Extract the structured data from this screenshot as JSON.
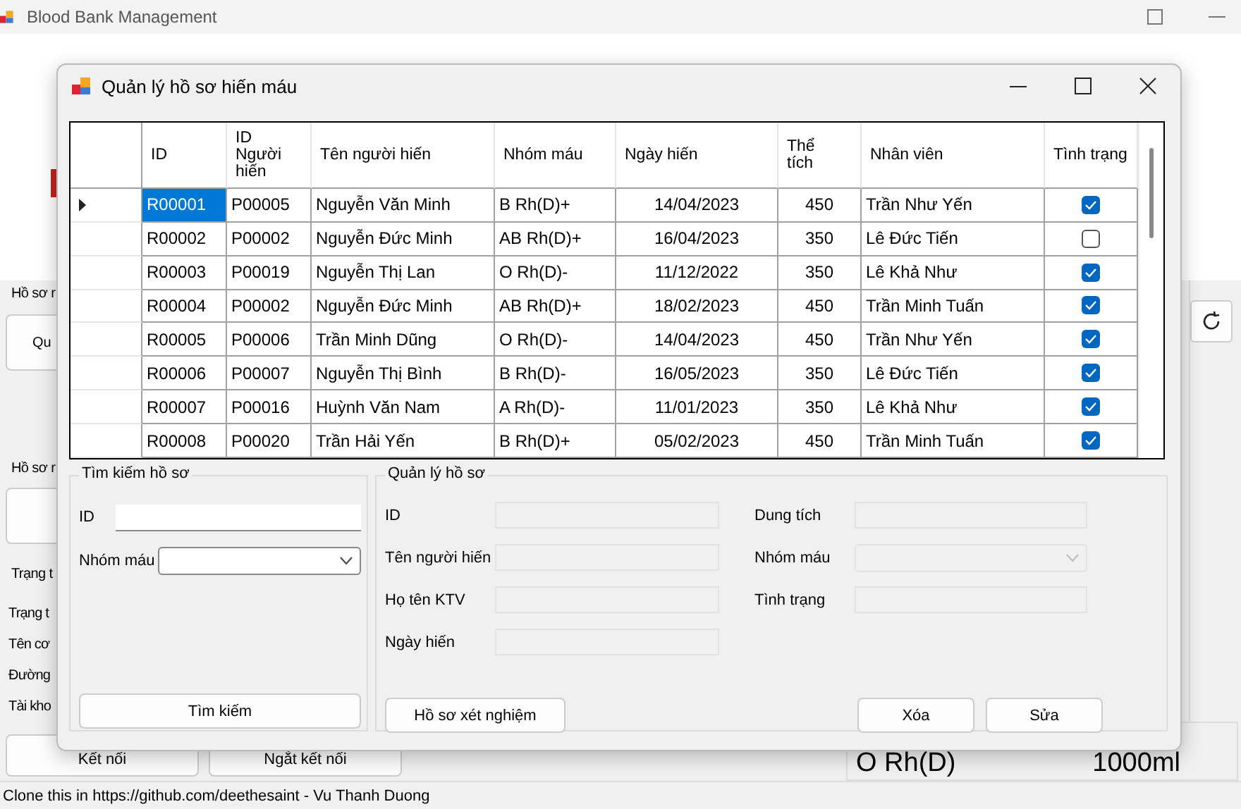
{
  "main_window": {
    "title": "Blood Bank Management"
  },
  "background": {
    "groups": [
      {
        "label": "Hồ sơ r",
        "button": "Qu"
      },
      {
        "label": "Hồ sơ r"
      }
    ],
    "status_group": {
      "label": "Trạng t",
      "lines": [
        "Trạng t",
        "Tên cơ",
        "Đường",
        "Tài kho"
      ]
    },
    "buttons": [
      "Kết nối",
      "Ngắt kết nối"
    ],
    "summary": [
      "O Rh(D)",
      "1000ml"
    ]
  },
  "status_bar": "Clone this in https://github.com/deethesaint - Vu Thanh Duong",
  "dialog": {
    "title": "Quản lý hồ sơ hiến máu",
    "table": {
      "columns": [
        "ID",
        "ID\nNgười\nhiến",
        "Tên người hiến",
        "Nhóm máu",
        "Ngày hiến",
        "Thể\ntích",
        "Nhân viên",
        "Tình trạng"
      ],
      "rows": [
        {
          "id": "R00001",
          "donor_id": "P00005",
          "name": "Nguyễn Văn Minh",
          "blood": "B Rh(D)+",
          "date": "14/04/2023",
          "volume": "450",
          "staff": "Trần Như Yến",
          "checked": true,
          "selected": true
        },
        {
          "id": "R00002",
          "donor_id": "P00002",
          "name": "Nguyễn Đức Minh",
          "blood": "AB Rh(D)+",
          "date": "16/04/2023",
          "volume": "350",
          "staff": "Lê Đức Tiến",
          "checked": false,
          "selected": false
        },
        {
          "id": "R00003",
          "donor_id": "P00019",
          "name": "Nguyễn Thị Lan",
          "blood": "O Rh(D)-",
          "date": "11/12/2022",
          "volume": "350",
          "staff": "Lê Khả Như",
          "checked": true,
          "selected": false
        },
        {
          "id": "R00004",
          "donor_id": "P00002",
          "name": "Nguyễn Đức Minh",
          "blood": "AB Rh(D)+",
          "date": "18/02/2023",
          "volume": "450",
          "staff": "Trần Minh Tuấn",
          "checked": true,
          "selected": false
        },
        {
          "id": "R00005",
          "donor_id": "P00006",
          "name": "Trần Minh Dũng",
          "blood": "O Rh(D)-",
          "date": "14/04/2023",
          "volume": "450",
          "staff": "Trần Như Yến",
          "checked": true,
          "selected": false
        },
        {
          "id": "R00006",
          "donor_id": "P00007",
          "name": "Nguyễn Thị Bình",
          "blood": "B Rh(D)-",
          "date": "16/05/2023",
          "volume": "350",
          "staff": "Lê Đức Tiến",
          "checked": true,
          "selected": false
        },
        {
          "id": "R00007",
          "donor_id": "P00016",
          "name": "Huỳnh Văn Nam",
          "blood": "A Rh(D)-",
          "date": "11/01/2023",
          "volume": "350",
          "staff": "Lê Khả Như",
          "checked": true,
          "selected": false
        },
        {
          "id": "R00008",
          "donor_id": "P00020",
          "name": "Trần Hải Yến",
          "blood": "B Rh(D)+",
          "date": "05/02/2023",
          "volume": "450",
          "staff": "Trần Minh Tuấn",
          "checked": true,
          "selected": false
        }
      ]
    },
    "search": {
      "title": "Tìm kiếm hồ sơ",
      "fields": [
        {
          "label": "ID",
          "kind": "text"
        },
        {
          "label": "Nhóm máu",
          "kind": "combo"
        }
      ],
      "button": "Tìm kiếm"
    },
    "manage": {
      "title": "Quản lý hồ sơ",
      "left_fields": [
        {
          "label": "ID",
          "kind": "text",
          "disabled": true
        },
        {
          "label": "Tên người hiến",
          "kind": "text",
          "disabled": true
        },
        {
          "label": "Họ tên KTV",
          "kind": "text",
          "disabled": true
        },
        {
          "label": "Ngày hiến",
          "kind": "text",
          "disabled": true
        }
      ],
      "right_fields": [
        {
          "label": "Dung tích",
          "kind": "text",
          "disabled": true
        },
        {
          "label": "Nhóm máu",
          "kind": "combo",
          "disabled": true
        },
        {
          "label": "Tình trạng",
          "kind": "text",
          "disabled": true
        }
      ],
      "buttons": [
        "Hồ sơ xét nghiệm",
        "Xóa",
        "Sửa"
      ]
    }
  }
}
